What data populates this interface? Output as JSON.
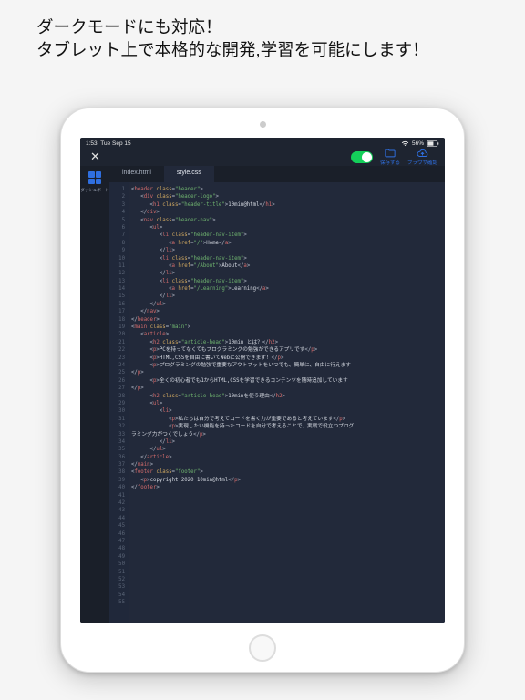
{
  "promo": {
    "line1": "ダークモードにも対応！",
    "line2": "タブレット上で本格的な開発,学習を可能にします！"
  },
  "statusbar": {
    "time": "1:53",
    "date": "Tue Sep 15",
    "battery_pct": "56%"
  },
  "topbar": {
    "close": "✕",
    "save_label": "保存する",
    "browser_label": "ブラウザ確認"
  },
  "sidebar": {
    "dashboard_label": "ダッシュボード"
  },
  "tabs": {
    "items": [
      {
        "label": "index.html",
        "active": false
      },
      {
        "label": "style.css",
        "active": true
      }
    ]
  },
  "code": {
    "last_line": 55,
    "lines": [
      {
        "n": 1,
        "indent": 0,
        "kind": "open",
        "tag": "header",
        "attr": "class",
        "val": "header"
      },
      {
        "n": 2,
        "indent": 1,
        "kind": "open",
        "tag": "div",
        "attr": "class",
        "val": "header-logo"
      },
      {
        "n": 3,
        "indent": 2,
        "kind": "openclose",
        "tag": "h1",
        "attr": "class",
        "val": "header-title",
        "text": "10min@html"
      },
      {
        "n": 4,
        "indent": 1,
        "kind": "close",
        "tag": "div"
      },
      {
        "n": 5,
        "indent": 1,
        "kind": "open",
        "tag": "nav",
        "attr": "class",
        "val": "header-nav"
      },
      {
        "n": 6,
        "indent": 2,
        "kind": "open",
        "tag": "ul"
      },
      {
        "n": 7,
        "indent": 3,
        "kind": "open",
        "tag": "li",
        "attr": "class",
        "val": "header-nav-item"
      },
      {
        "n": 8,
        "indent": 4,
        "kind": "openclose",
        "tag": "a",
        "attr": "href",
        "val": "/",
        "text": "Home"
      },
      {
        "n": 9,
        "indent": 3,
        "kind": "close",
        "tag": "li"
      },
      {
        "n": 10,
        "indent": 3,
        "kind": "open",
        "tag": "li",
        "attr": "class",
        "val": "header-nav-item"
      },
      {
        "n": 11,
        "indent": 4,
        "kind": "openclose",
        "tag": "a",
        "attr": "href",
        "val": "/About",
        "text": "About"
      },
      {
        "n": 12,
        "indent": 3,
        "kind": "close",
        "tag": "li"
      },
      {
        "n": 13,
        "indent": 3,
        "kind": "open",
        "tag": "li",
        "attr": "class",
        "val": "header-nav-item"
      },
      {
        "n": 14,
        "indent": 4,
        "kind": "openclose",
        "tag": "a",
        "attr": "href",
        "val": "/Learning",
        "text": "Learning"
      },
      {
        "n": 15,
        "indent": 3,
        "kind": "close",
        "tag": "li"
      },
      {
        "n": 16,
        "indent": 2,
        "kind": "close",
        "tag": "ul"
      },
      {
        "n": 17,
        "indent": 1,
        "kind": "close",
        "tag": "nav"
      },
      {
        "n": 18,
        "indent": 0,
        "kind": "close",
        "tag": "header"
      },
      {
        "n": 19,
        "indent": 0,
        "kind": "open",
        "tag": "main",
        "attr": "class",
        "val": "main"
      },
      {
        "n": 20,
        "indent": 1,
        "kind": "open",
        "tag": "article"
      },
      {
        "n": 21,
        "indent": 2,
        "kind": "openclose",
        "tag": "h2",
        "attr": "class",
        "val": "article-head",
        "text": "10min とは？"
      },
      {
        "n": 22,
        "indent": 2,
        "kind": "p",
        "text": "PCを持ってなくてもプログラミングの勉強ができるアプリです"
      },
      {
        "n": 23,
        "indent": 2,
        "kind": "p",
        "text": "HTML,CSSを自由に書いてWebに公開できます！"
      },
      {
        "n": 24,
        "indent": 2,
        "kind": "pwrap",
        "text": "プログラミングの勉強で重要なアウトプットをいつでも、簡単に、自由に行えます"
      },
      {
        "n": 25,
        "indent": 0,
        "kind": "closewrap",
        "tag": "p"
      },
      {
        "n": 26,
        "indent": 2,
        "kind": "pwrap",
        "text": "全くの初心者でも1からHTML,CSSを学習できるコンテンツを随時追加しています"
      },
      {
        "n": 27,
        "indent": 0,
        "kind": "closewrap",
        "tag": "p"
      },
      {
        "n": 28,
        "indent": 2,
        "kind": "openclose",
        "tag": "h2",
        "attr": "class",
        "val": "article-head",
        "text": "10minを使う理由"
      },
      {
        "n": 29,
        "indent": 2,
        "kind": "open",
        "tag": "ul"
      },
      {
        "n": 30,
        "indent": 3,
        "kind": "open",
        "tag": "li"
      },
      {
        "n": 31,
        "indent": 4,
        "kind": "p",
        "text": "私たちは自分で考えてコードを書く力が重要であると考えています"
      },
      {
        "n": 32,
        "indent": 4,
        "kind": "pwrap",
        "text": "実現したい機能を持ったコードを自分で考えることで、実戦で役立つプログ"
      },
      {
        "n": 33,
        "indent": 0,
        "kind": "textline",
        "text": "ラミング力がつくでしょう"
      },
      {
        "n": 34,
        "indent": 3,
        "kind": "close",
        "tag": "li"
      },
      {
        "n": 35,
        "indent": 2,
        "kind": "close",
        "tag": "ul"
      },
      {
        "n": 36,
        "indent": 1,
        "kind": "close",
        "tag": "article"
      },
      {
        "n": 37,
        "indent": 0,
        "kind": "close",
        "tag": "main"
      },
      {
        "n": 38,
        "indent": 0,
        "kind": "open",
        "tag": "footer",
        "attr": "class",
        "val": "footer"
      },
      {
        "n": 39,
        "indent": 1,
        "kind": "p",
        "text": "copyright 2020 10min@html"
      },
      {
        "n": 40,
        "indent": 0,
        "kind": "close",
        "tag": "footer"
      }
    ]
  }
}
